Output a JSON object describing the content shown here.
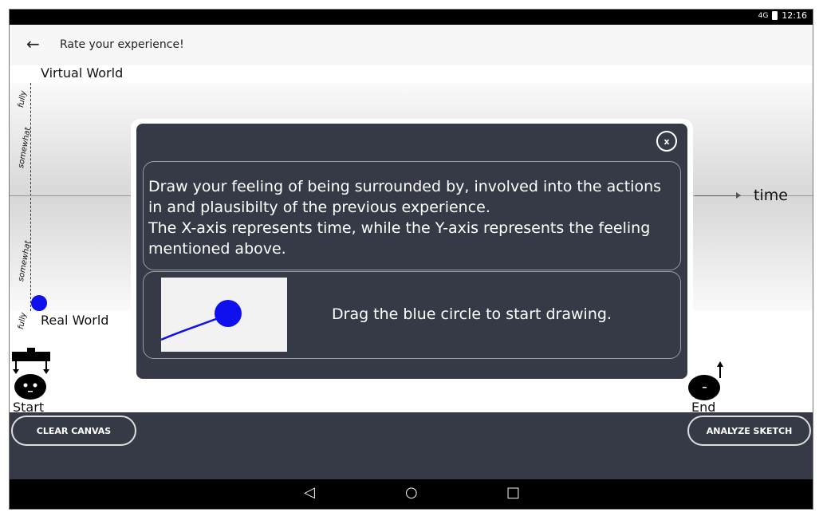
{
  "status_bar": {
    "signal": "4G",
    "time": "12:16"
  },
  "app_bar": {
    "title": "Rate your experience!"
  },
  "canvas": {
    "top_label": "Virtual World",
    "bottom_label": "Real World",
    "x_axis_label": "time",
    "y_ticks": [
      "fully",
      "somewhat",
      "somewhat",
      "fully"
    ],
    "start_label": "Start",
    "end_label": "End"
  },
  "dialog": {
    "close_label": "x",
    "message": "Draw your feeling of being surrounded by, involved into the actions in and plausibilty of the previous experience.\nThe X-axis represents time, while the Y-axis represents the feeling mentioned above.",
    "hint": "Drag the blue circle to start drawing."
  },
  "buttons": {
    "clear": "CLEAR CANVAS",
    "analyze": "ANALYZE SKETCH"
  },
  "nav": {
    "back": "◁",
    "home": "○",
    "recents": "□"
  },
  "colors": {
    "accent_blue": "#1010ee",
    "panel": "#363a47"
  }
}
